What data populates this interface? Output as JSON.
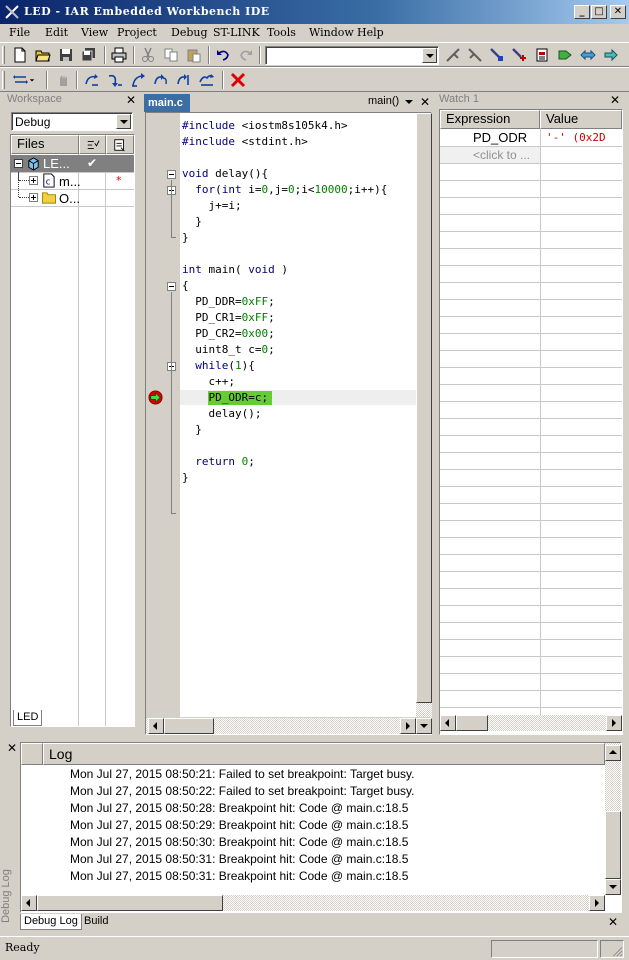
{
  "window": {
    "title": "LED - IAR Embedded Workbench IDE",
    "min_glyph": "_",
    "max_glyph": "□",
    "close_glyph": "✕"
  },
  "menu": [
    "File",
    "Edit",
    "View",
    "Project",
    "Debug",
    "ST-LINK",
    "Tools",
    "Window",
    "Help"
  ],
  "workspace": {
    "title": "Workspace",
    "config": "Debug",
    "files_header": "Files",
    "tree": [
      {
        "label": "LE...",
        "check": "✔"
      },
      {
        "label": "m...",
        "mark": "*"
      },
      {
        "label": "O..."
      }
    ],
    "tab": "LED"
  },
  "editor": {
    "tab": "main.c",
    "function": "main()",
    "lines": [
      [
        "#include <iostm8s105k4.h>"
      ],
      [
        "#include <stdint.h>"
      ],
      [
        ""
      ],
      [
        "void delay(){"
      ],
      [
        "  for(int i=0,j=0;i<10000;i++){"
      ],
      [
        "    j+=i;"
      ],
      [
        "  }"
      ],
      [
        "}"
      ],
      [
        ""
      ],
      [
        "int main( void )"
      ],
      [
        "{"
      ],
      [
        "  PD_DDR=0xFF;"
      ],
      [
        "  PD_CR1=0xFF;"
      ],
      [
        "  PD_CR2=0x00;"
      ],
      [
        "  uint8_t c=0;"
      ],
      [
        "  while(1){"
      ],
      [
        "    c++;"
      ],
      [
        "    PD_ODR=c;"
      ],
      [
        "    delay();"
      ],
      [
        "  }"
      ],
      [
        ""
      ],
      [
        "  return 0;"
      ],
      [
        "}"
      ]
    ]
  },
  "watch": {
    "title": "Watch 1",
    "col_expression": "Expression",
    "col_value": "Value",
    "rows": [
      {
        "expression": "PD_ODR",
        "value": "'-' (0x2D"
      },
      {
        "expression": "<click to ...",
        "value": ""
      }
    ]
  },
  "log": {
    "header": "Log",
    "side_label": "Debug Log",
    "entries": [
      "Mon Jul 27, 2015 08:50:21: Failed to set breakpoint: Target busy.",
      "Mon Jul 27, 2015 08:50:22: Failed to set breakpoint: Target busy.",
      "Mon Jul 27, 2015 08:50:28: Breakpoint hit: Code @ main.c:18.5",
      "Mon Jul 27, 2015 08:50:29: Breakpoint hit: Code @ main.c:18.5",
      "Mon Jul 27, 2015 08:50:30: Breakpoint hit: Code @ main.c:18.5",
      "Mon Jul 27, 2015 08:50:31: Breakpoint hit: Code @ main.c:18.5",
      "Mon Jul 27, 2015 08:50:31: Breakpoint hit: Code @ main.c:18.5"
    ],
    "tabs": [
      "Debug Log",
      "Build"
    ]
  },
  "status": {
    "text": "Ready"
  },
  "close_glyph": "✕",
  "colors": {
    "breakpoint_highlight": "#66cc33",
    "title_bar": "#0a246a",
    "keyword": "#000080",
    "number": "#008000",
    "string": "#cc0000"
  }
}
